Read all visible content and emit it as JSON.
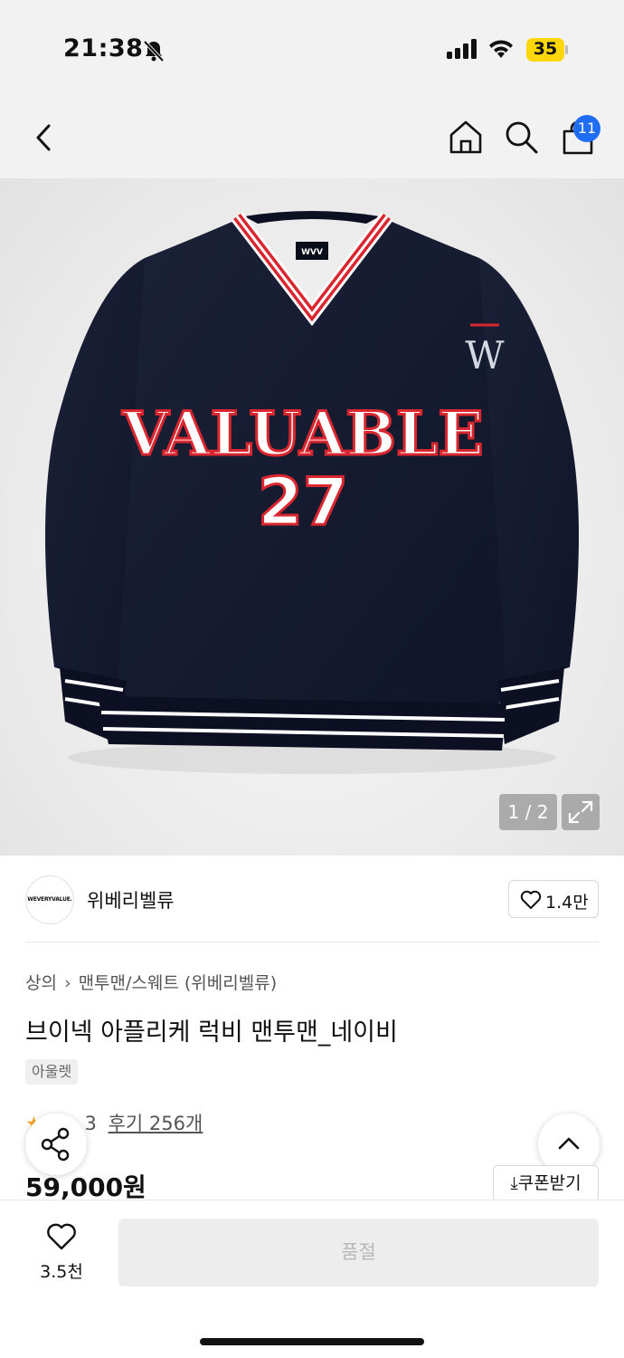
{
  "status_bar": {
    "time": "21:38",
    "battery": "35",
    "battery_color": "#ffd60a"
  },
  "nav": {
    "back_icon": "chevron-left-icon",
    "home_icon": "home-icon",
    "search_icon": "search-icon",
    "cart_icon": "shopping-bag-icon",
    "cart_count": "11",
    "badge_color": "#1e6df2"
  },
  "gallery": {
    "counter": "1 / 2",
    "garment_print": "VALUABLE",
    "garment_number": "27",
    "garment_label": "WVV",
    "sleeve_logo": "W",
    "expand_icon": "expand-icon"
  },
  "brand": {
    "logo_text": "WEVERYVALUE.",
    "name": "위베리벨류",
    "likes": "1.4만"
  },
  "product": {
    "breadcrumb": [
      "상의",
      "맨투맨/스웨트 (위베리벨류)"
    ],
    "title": "브이넥 아플리케 럭비 맨투맨_네이비",
    "tag": "아울렛",
    "rating_prefix": "★",
    "rating_partial": "3",
    "review_link": "후기 256개",
    "price": "59,000원",
    "coupon_label": "⤓쿠폰받기"
  },
  "bottom_bar": {
    "wish_count": "3.5천",
    "buy_button_label": "품절"
  }
}
